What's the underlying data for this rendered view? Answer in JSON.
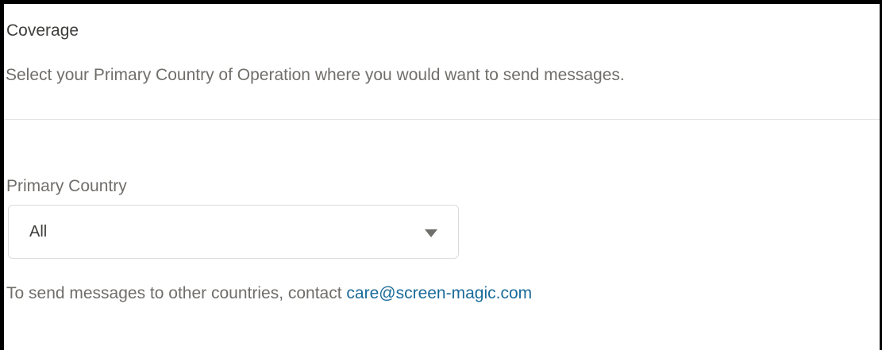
{
  "coverage": {
    "title": "Coverage",
    "description": "Select your Primary Country of Operation where you would want to send messages."
  },
  "primary_country": {
    "label": "Primary Country",
    "selected_value": "All"
  },
  "help": {
    "text": "To send messages to other countries, contact ",
    "link_text": "care@screen-magic.com"
  },
  "colors": {
    "link": "#1a6b9a",
    "text_primary": "#3e3e3c",
    "text_secondary": "#706e6b",
    "border": "#dddbda"
  }
}
